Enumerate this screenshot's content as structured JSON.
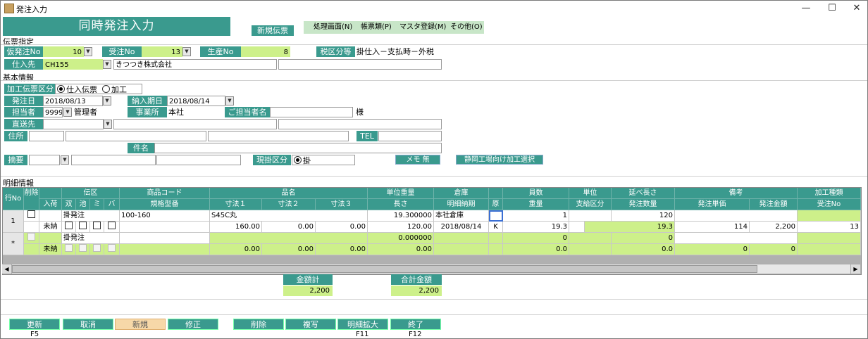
{
  "window": {
    "title": "発注入力",
    "minimize": "—",
    "maximize": "☐",
    "close": "✕"
  },
  "form_name": "同時発注入力",
  "mode_badge": "新規伝票",
  "menu": [
    "処理画面(N)",
    "帳票類(P)",
    "マスタ登録(M)",
    "その他(O)"
  ],
  "sections": {
    "denpyo": "伝票指定",
    "kihon": "基本情報",
    "meisai": "明細情報"
  },
  "denpyo": {
    "karihachu_label": "仮発注No",
    "karihachu_value": "10",
    "juchu_label": "受注No",
    "juchu_value": "13",
    "seisan_label": "生産No",
    "seisan_value": "8",
    "zei_label": "税区分等",
    "zei_value": "掛仕入－支払時－外税",
    "shiiresaki_label": "仕入先",
    "shiiresaki_code": "CH155",
    "shiiresaki_name": "きつつき株式会社"
  },
  "kihon": {
    "kakou_label": "加工伝票区分",
    "kakou_opt1": "仕入伝票",
    "kakou_opt2": "加工",
    "hachubi_label": "発注日",
    "hachubi_value": "2018/08/13",
    "nyukibi_label": "納入期日",
    "nyukibi_value": "2018/08/14",
    "tantou_label": "担当者",
    "tantou_code": "9999",
    "tantou_name": "管理者",
    "jigyousho_label": "事業所",
    "jigyousho_value": "本社",
    "gotantou_label": "ご担当者名",
    "sama": "様",
    "chokusou_label": "直送先",
    "jusho_label": "住所",
    "tel_label": "TEL",
    "kenmei_label": "件名",
    "tekiyou_label": "摘要",
    "genkake_label": "現掛区分",
    "genkake_value": "掛",
    "memo_button": "メモ 無",
    "shizuoka_button": "静岡工場向け加工選択"
  },
  "grid": {
    "h1": {
      "rowno": "行No",
      "sakujo": "削除",
      "denku": "伝区",
      "shohin": "商品コード",
      "hinmei": "品名",
      "tanijuryo": "単位重量",
      "souko": "倉庫",
      "kosuu": "員数",
      "tani": "単位",
      "nobe": "延べ長さ",
      "bikou": "備考",
      "kakou": "加工種類"
    },
    "h2": {
      "nyuka": "入荷",
      "sou": "双",
      "ike": "池",
      "mi": "ミ",
      "ba": "バ",
      "kikaku": "規格型番",
      "sun1": "寸法１",
      "sun2": "寸法２",
      "sun3": "寸法３",
      "nagasa": "長さ",
      "meisai_nouki": "明細納期",
      "gen": "原",
      "juryo": "重量",
      "shiharai": "支給区分",
      "hachusuu": "発注数量",
      "tanka": "発注単価",
      "kingaku": "発注金額",
      "juchuno": "受注No"
    },
    "row1": {
      "no": "1",
      "denku": "掛発注",
      "nyuka": "未納",
      "shohin": "100-160",
      "hinmei": "S45C丸",
      "tanijuryo": "19.300000",
      "souko": "本社倉庫",
      "kosuu": "1",
      "nobe": "120",
      "sun1": "160.00",
      "sun2": "0.00",
      "sun3": "0.00",
      "nagasa": "120.00",
      "nouki": "2018/08/14",
      "gen": "K",
      "juryo": "19.3",
      "hachusuu": "19.3",
      "tanka": "114",
      "kingaku": "2,200",
      "juchuno": "13"
    },
    "row_new": {
      "no": "*",
      "denku": "掛発注",
      "nyuka": "未納",
      "tanijuryo": "0.000000",
      "kosuu": "0",
      "nobe": "0",
      "sun1": "0.00",
      "sun2": "0.00",
      "sun3": "0.00",
      "nagasa": "0.00",
      "juryo": "0.0",
      "hachusuu": "0.0",
      "tanka": "0",
      "kingaku": "0"
    }
  },
  "totals": {
    "kingaku_label": "金額計",
    "kingaku_value": "2,200",
    "goukei_label": "合計金額",
    "goukei_value": "2,200"
  },
  "buttons": [
    {
      "label": "更新",
      "key": "F5"
    },
    {
      "label": "取消",
      "key": ""
    },
    {
      "label": "新規",
      "key": ""
    },
    {
      "label": "修正",
      "key": ""
    },
    {
      "label": "削除",
      "key": ""
    },
    {
      "label": "複写",
      "key": ""
    },
    {
      "label": "明細拡大",
      "key": "F11"
    },
    {
      "label": "終了",
      "key": "F12"
    }
  ]
}
